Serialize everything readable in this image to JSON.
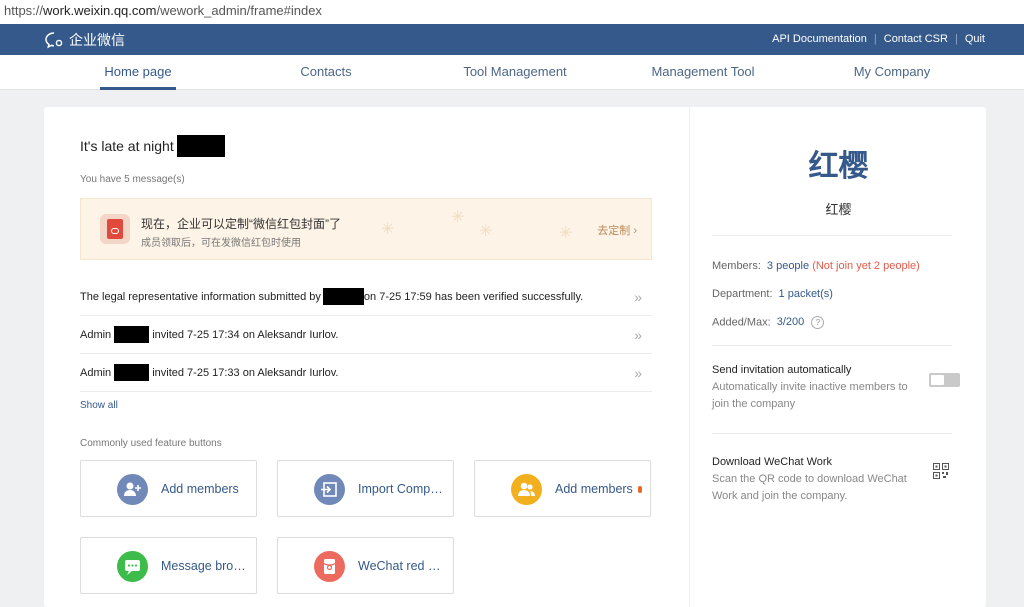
{
  "browser": {
    "url_prefix": "https://",
    "url_host": "work.weixin.qq.com",
    "url_path": "/wework_admin/frame#index"
  },
  "header": {
    "logo_text": "企业微信",
    "links": [
      "API Documentation",
      "Contact CSR",
      "Quit"
    ],
    "color": "#35598a"
  },
  "nav": {
    "tabs": [
      "Home page",
      "Contacts",
      "Tool Management",
      "Management Tool",
      "My Company"
    ],
    "active": "Home page"
  },
  "main": {
    "greeting": "It's late at night",
    "message_count": "You have 5 message(s)",
    "banner": {
      "title": "现在，企业可以定制“微信红包封面”了",
      "subtitle": "成员领取后，可在发微信红包时使用",
      "cta": "去定制 ›"
    },
    "messages": [
      {
        "before": "The legal representative information submitted by",
        "after": "on 7-25 17:59 has been verified successfully."
      },
      {
        "before": "Admin",
        "after": "invited 7-25 17:34 on Aleksandr Iurlov."
      },
      {
        "before": "Admin",
        "after": "invited 7-25 17:33 on Aleksandr Iurlov."
      }
    ],
    "arrow": "»",
    "show_all": "Show all",
    "features_label": "Commonly used feature buttons",
    "features": [
      {
        "label": "Add members",
        "icon": "add-member-icon",
        "color": "#7189b8"
      },
      {
        "label": "Import Comp…",
        "icon": "import-icon",
        "color": "#7189b8"
      },
      {
        "label": "Add members",
        "icon": "add-members-group-icon",
        "color": "#f2b01e"
      },
      {
        "label": "Message bro…",
        "icon": "message-broadcast-icon",
        "color": "#3dbb4b"
      },
      {
        "label": "WeChat red …",
        "icon": "red-packet-icon",
        "color": "#ec6b5e"
      }
    ]
  },
  "sidebar": {
    "company_big": "红樱",
    "company_name": "红樱",
    "members_label": "Members:",
    "members_value": "3 people",
    "members_note": "(Not join yet 2 people)",
    "department_label": "Department:",
    "department_value": "1 packet(s)",
    "added_label": "Added/Max:",
    "added_value": "3/200",
    "help_glyph": "?",
    "invite_title": "Send invitation automatically",
    "invite_desc": "Automatically invite inactive members to join the company",
    "invite_enabled": false,
    "download_title": "Download WeChat Work",
    "download_desc": "Scan the QR code to download WeChat Work and join the company."
  }
}
